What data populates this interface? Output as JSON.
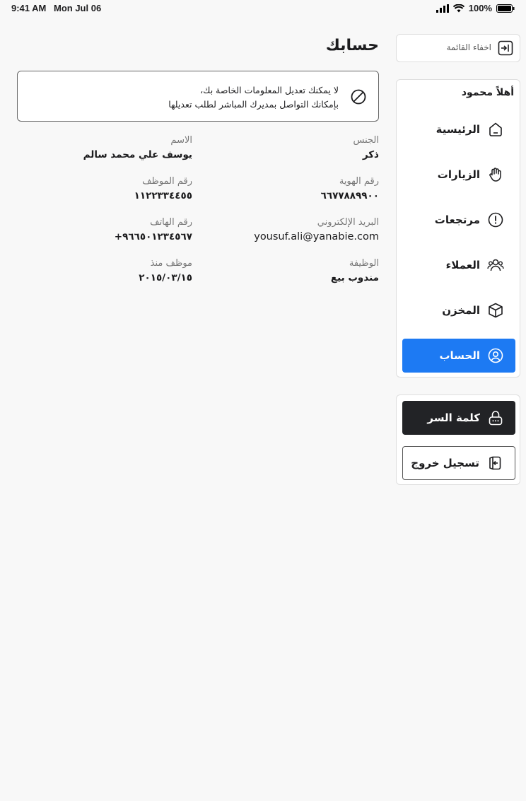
{
  "status_bar": {
    "time": "9:41 AM",
    "date": "Mon Jul 06",
    "battery": "100%"
  },
  "sidebar": {
    "hide_menu_label": "اخفاء القائمة",
    "greeting": "أهلاً محمود",
    "items": [
      {
        "label": "الرئيسية",
        "icon": "home-icon"
      },
      {
        "label": "الزيارات",
        "icon": "hand-icon"
      },
      {
        "label": "مرتجعات",
        "icon": "alert-circle-icon"
      },
      {
        "label": "العملاء",
        "icon": "users-icon"
      },
      {
        "label": "المخزن",
        "icon": "box-icon"
      },
      {
        "label": "الحساب",
        "icon": "user-circle-icon",
        "active": true
      }
    ],
    "password_label": "كلمة السر",
    "logout_label": "تسجيل خروج"
  },
  "main": {
    "title": "حسابك",
    "notice_line1": "لا يمكنك تعديل المعلومات الخاصة بك،",
    "notice_line2": "بإمكانك التواصل بمديرك المباشر لطلب تعديلها",
    "fields": {
      "gender": {
        "label": "الجنس",
        "value": "ذكر"
      },
      "name": {
        "label": "الاسم",
        "value": "يوسف علي محمد سالم"
      },
      "id_number": {
        "label": "رقم الهوية",
        "value": "٦٦٧٧٨٨٩٩٠٠"
      },
      "employee_number": {
        "label": "رقم الموظف",
        "value": "١١٢٢٣٣٤٤٥٥"
      },
      "email": {
        "label": "البريد الإلكتروني",
        "value": "yousuf.ali@yanabie.com"
      },
      "phone": {
        "label": "رقم الهاتف",
        "value": "+٩٦٦٥٠١٢٣٤٥٦٧"
      },
      "job": {
        "label": "الوظيفة",
        "value": "مندوب بيع"
      },
      "employed_since": {
        "label": "موظف منذ",
        "value": "٢٠١٥/٠٣/١٥"
      }
    }
  },
  "colors": {
    "accent": "#1d7af3",
    "dark_button": "#222326",
    "background": "#f8f8f8"
  }
}
